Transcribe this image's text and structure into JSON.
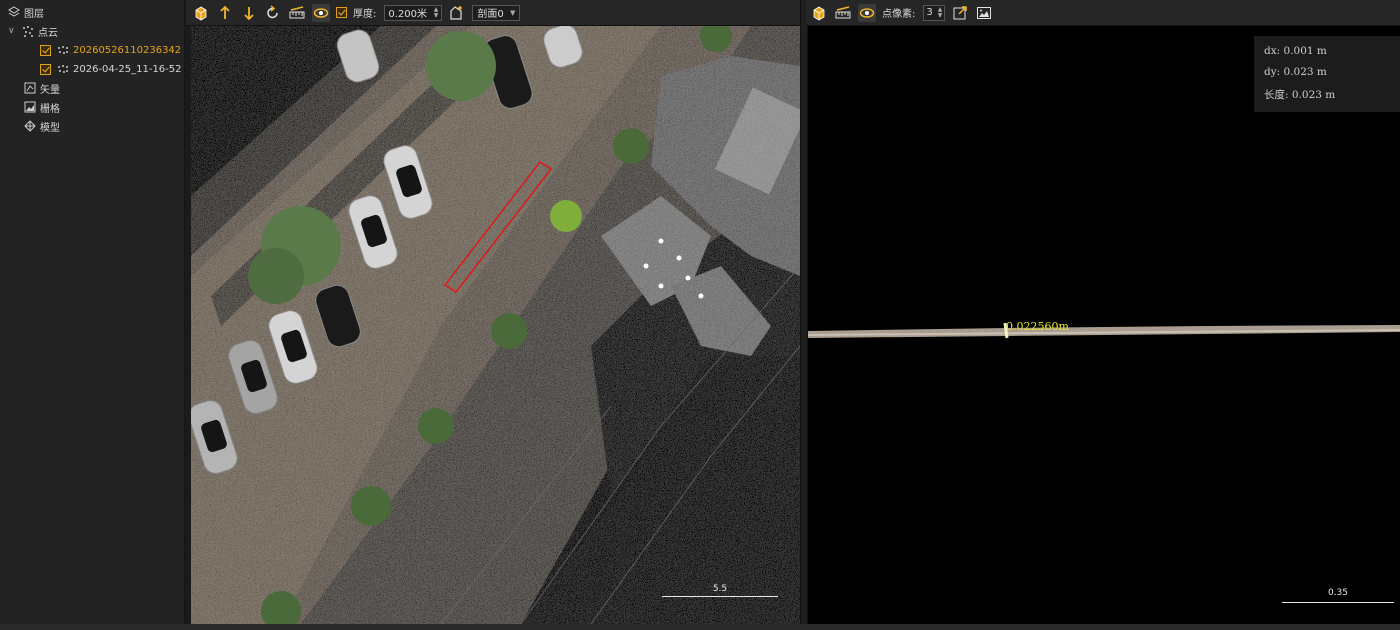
{
  "sidebar": {
    "root": {
      "label": "图层",
      "icon": "layers-icon"
    },
    "pointcloud_group": {
      "label": "点云",
      "icon": "point-cloud-icon"
    },
    "pointcloud_items": [
      {
        "label": "20260526110236342",
        "checked": true,
        "selected": true
      },
      {
        "label": "2026-04-25_11-16-52",
        "checked": true,
        "selected": false
      }
    ],
    "others": [
      {
        "label": "矢量",
        "icon": "vector-icon"
      },
      {
        "label": "栅格",
        "icon": "raster-icon"
      },
      {
        "label": "模型",
        "icon": "model-icon"
      }
    ]
  },
  "left_toolbar": {
    "thickness_label": "厚度:",
    "thickness_value": "0.200米",
    "section_value": "剖面0"
  },
  "right_toolbar": {
    "point_pixel_label": "点像素:",
    "point_pixel_value": "3"
  },
  "left_view": {
    "scale_label": "5.5"
  },
  "right_view": {
    "dx": "dx: 0.001 m",
    "dy": "dy: 0.023 m",
    "length": "长度: 0.023 m",
    "measure_label": "0.022560m",
    "scale_label": "0.35"
  },
  "colors": {
    "accent": "#f0b52a",
    "section_rect": "#e01818",
    "measure_text": "#e8e82a"
  }
}
